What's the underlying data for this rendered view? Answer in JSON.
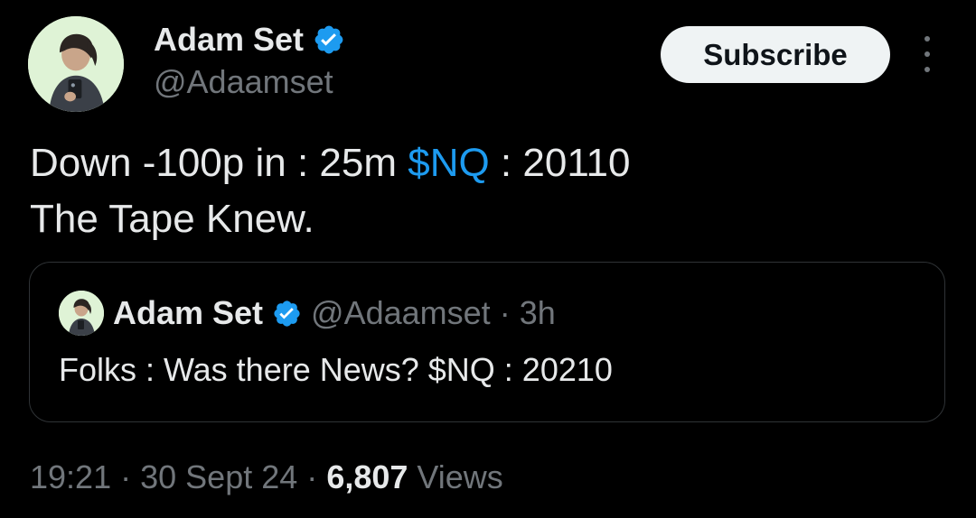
{
  "author": {
    "display_name": "Adam Set",
    "handle": "@Adaamset",
    "verified": true
  },
  "subscribe_label": "Subscribe",
  "tweet": {
    "line1_prefix": "Down -100p in : 25m ",
    "line1_cashtag": "$NQ",
    "line1_suffix": " : 20110",
    "line2": "The Tape Knew."
  },
  "quote": {
    "display_name": "Adam Set",
    "handle": "@Adaamset",
    "separator": "·",
    "time": "3h",
    "text": "Folks : Was there News? $NQ : 20210"
  },
  "footer": {
    "time": "19:21",
    "separator": "·",
    "date": "30 Sept 24",
    "views_count": "6,807",
    "views_label": "Views"
  },
  "icons": {
    "verified": "verified-badge-icon",
    "more": "more-options-icon"
  },
  "colors": {
    "background": "#000000",
    "primary_text": "#e7e9ea",
    "secondary_text": "#71767b",
    "link": "#1d9bf0",
    "verified": "#1d9bf0",
    "button_bg": "#eff3f4",
    "button_text": "#0f1419",
    "border": "#2f3336"
  }
}
